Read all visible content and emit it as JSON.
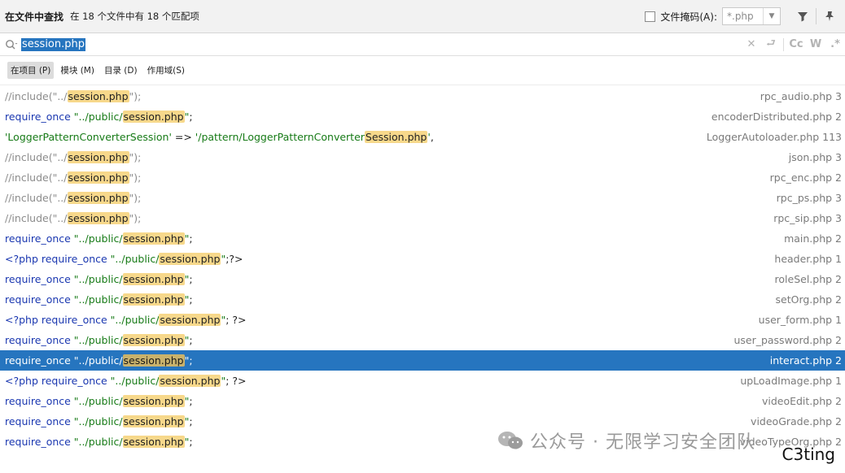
{
  "header": {
    "title": "在文件中查找",
    "match_count": "在 18 个文件中有 18 个匹配项",
    "file_mask_label": "文件掩码(A):",
    "file_mask_value": "*.php"
  },
  "search": {
    "query": "session.php"
  },
  "scopes": [
    {
      "label": "在项目 (P)",
      "active": true
    },
    {
      "label": "模块 (M)",
      "active": false
    },
    {
      "label": "目录 (D)",
      "active": false
    },
    {
      "label": "作用域(S)",
      "active": false
    }
  ],
  "results": [
    {
      "segs": [
        {
          "t": "cm",
          "v": "//include(\"../"
        },
        {
          "t": "hl",
          "v": "session.php"
        },
        {
          "t": "cm",
          "v": "\");"
        }
      ],
      "file": "rpc_audio.php 3"
    },
    {
      "segs": [
        {
          "t": "kw",
          "v": "require_once "
        },
        {
          "t": "str",
          "v": "\"../public/"
        },
        {
          "t": "hl",
          "v": "session.php"
        },
        {
          "t": "str",
          "v": "\""
        },
        {
          "t": "txt",
          "v": ";"
        }
      ],
      "file": "encoderDistributed.php 2"
    },
    {
      "segs": [
        {
          "t": "str",
          "v": "'LoggerPatternConverterSession'"
        },
        {
          "t": "txt",
          "v": " => "
        },
        {
          "t": "str",
          "v": "'/pattern/LoggerPatternConverter"
        },
        {
          "t": "hl",
          "v": "Session.php"
        },
        {
          "t": "str",
          "v": "'"
        },
        {
          "t": "txt",
          "v": ","
        }
      ],
      "file": "LoggerAutoloader.php 113"
    },
    {
      "segs": [
        {
          "t": "cm",
          "v": "//include(\"../"
        },
        {
          "t": "hl",
          "v": "session.php"
        },
        {
          "t": "cm",
          "v": "\");"
        }
      ],
      "file": "json.php 3"
    },
    {
      "segs": [
        {
          "t": "cm",
          "v": "//include(\"../"
        },
        {
          "t": "hl",
          "v": "session.php"
        },
        {
          "t": "cm",
          "v": "\");"
        }
      ],
      "file": "rpc_enc.php 2"
    },
    {
      "segs": [
        {
          "t": "cm",
          "v": "//include(\"../"
        },
        {
          "t": "hl",
          "v": "session.php"
        },
        {
          "t": "cm",
          "v": "\");"
        }
      ],
      "file": "rpc_ps.php 3"
    },
    {
      "segs": [
        {
          "t": "cm",
          "v": "//include(\"../"
        },
        {
          "t": "hl",
          "v": "session.php"
        },
        {
          "t": "cm",
          "v": "\");"
        }
      ],
      "file": "rpc_sip.php 3"
    },
    {
      "segs": [
        {
          "t": "kw",
          "v": "require_once "
        },
        {
          "t": "str",
          "v": "\"../public/"
        },
        {
          "t": "hl",
          "v": "session.php"
        },
        {
          "t": "str",
          "v": "\""
        },
        {
          "t": "txt",
          "v": ";"
        }
      ],
      "file": "main.php 2"
    },
    {
      "segs": [
        {
          "t": "kw",
          "v": "<?php require_once "
        },
        {
          "t": "str",
          "v": "\"../public/"
        },
        {
          "t": "hl",
          "v": "session.php"
        },
        {
          "t": "str",
          "v": "\""
        },
        {
          "t": "txt",
          "v": ";?>"
        }
      ],
      "file": "header.php 1"
    },
    {
      "segs": [
        {
          "t": "kw",
          "v": "require_once "
        },
        {
          "t": "str",
          "v": "\"../public/"
        },
        {
          "t": "hl",
          "v": "session.php"
        },
        {
          "t": "str",
          "v": "\""
        },
        {
          "t": "txt",
          "v": ";"
        }
      ],
      "file": "roleSel.php 2"
    },
    {
      "segs": [
        {
          "t": "kw",
          "v": "require_once "
        },
        {
          "t": "str",
          "v": "\"../public/"
        },
        {
          "t": "hl",
          "v": "session.php"
        },
        {
          "t": "str",
          "v": "\""
        },
        {
          "t": "txt",
          "v": ";"
        }
      ],
      "file": "setOrg.php 2"
    },
    {
      "segs": [
        {
          "t": "kw",
          "v": "<?php require_once "
        },
        {
          "t": "str",
          "v": "\"../public/"
        },
        {
          "t": "hl",
          "v": "session.php"
        },
        {
          "t": "str",
          "v": "\""
        },
        {
          "t": "txt",
          "v": "; ?>"
        }
      ],
      "file": "user_form.php 1"
    },
    {
      "segs": [
        {
          "t": "kw",
          "v": "require_once "
        },
        {
          "t": "str",
          "v": "\"../public/"
        },
        {
          "t": "hl",
          "v": "session.php"
        },
        {
          "t": "str",
          "v": "\""
        },
        {
          "t": "txt",
          "v": ";"
        }
      ],
      "file": "user_password.php 2"
    },
    {
      "segs": [
        {
          "t": "kw",
          "v": "require_once "
        },
        {
          "t": "str",
          "v": "\"../public/"
        },
        {
          "t": "hl",
          "v": "session.php"
        },
        {
          "t": "str",
          "v": "\""
        },
        {
          "t": "txt",
          "v": ";"
        }
      ],
      "file": "interact.php 2",
      "selected": true
    },
    {
      "segs": [
        {
          "t": "kw",
          "v": "<?php require_once "
        },
        {
          "t": "str",
          "v": "\"../public/"
        },
        {
          "t": "hl",
          "v": "session.php"
        },
        {
          "t": "str",
          "v": "\""
        },
        {
          "t": "txt",
          "v": "; ?>"
        }
      ],
      "file": "upLoadImage.php 1"
    },
    {
      "segs": [
        {
          "t": "kw",
          "v": "require_once "
        },
        {
          "t": "str",
          "v": "\"../public/"
        },
        {
          "t": "hl",
          "v": "session.php"
        },
        {
          "t": "str",
          "v": "\""
        },
        {
          "t": "txt",
          "v": ";"
        }
      ],
      "file": "videoEdit.php 2"
    },
    {
      "segs": [
        {
          "t": "kw",
          "v": "require_once "
        },
        {
          "t": "str",
          "v": "\"../public/"
        },
        {
          "t": "hl",
          "v": "session.php"
        },
        {
          "t": "str",
          "v": "\""
        },
        {
          "t": "txt",
          "v": ";"
        }
      ],
      "file": "videoGrade.php 2"
    },
    {
      "segs": [
        {
          "t": "kw",
          "v": "require_once "
        },
        {
          "t": "str",
          "v": "\"../public/"
        },
        {
          "t": "hl",
          "v": "session.php"
        },
        {
          "t": "str",
          "v": "\""
        },
        {
          "t": "txt",
          "v": ";"
        }
      ],
      "file": "videoTypeOrg.php 2"
    }
  ],
  "watermark": {
    "text": "公众号 · 无限学习安全团队",
    "brand": "C3ting"
  },
  "colors": {
    "selection": "#2675bf",
    "highlight": "#f7d88b",
    "keyword": "#1a37b0",
    "string": "#167a16",
    "comment": "#8c8c8c"
  }
}
